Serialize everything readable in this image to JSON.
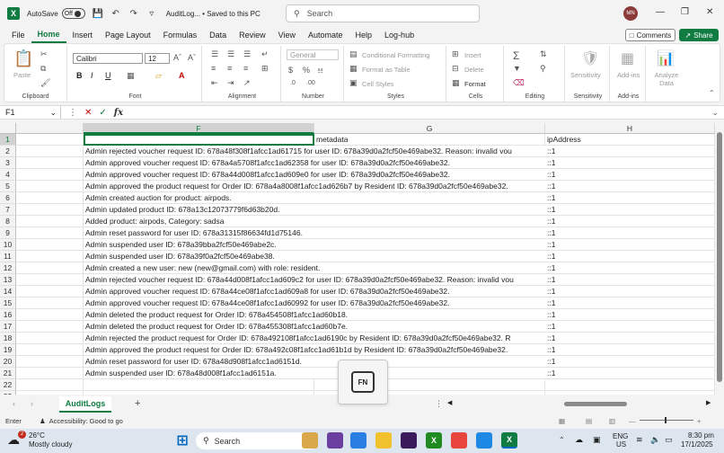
{
  "titlebar": {
    "autosave_label": "AutoSave",
    "autosave_state": "Off",
    "doc_title": "AuditLog... • Saved to this PC",
    "search_placeholder": "Search",
    "user_initials": "MN"
  },
  "menu": {
    "items": [
      "File",
      "Home",
      "Insert",
      "Page Layout",
      "Formulas",
      "Data",
      "Review",
      "View",
      "Automate",
      "Help",
      "Log-hub"
    ],
    "active": "Home",
    "comments_label": "Comments",
    "share_label": "Share"
  },
  "ribbon": {
    "clipboard": {
      "label": "Clipboard",
      "paste": "Paste"
    },
    "font": {
      "label": "Font",
      "name": "Calibri",
      "size": "12"
    },
    "alignment": {
      "label": "Alignment"
    },
    "number": {
      "label": "Number",
      "format": "General"
    },
    "styles": {
      "label": "Styles",
      "conditional": "Conditional Formatting",
      "table": "Format as Table",
      "cell_styles": "Cell Styles"
    },
    "cells": {
      "label": "Cells",
      "insert": "Insert",
      "delete": "Delete",
      "format": "Format"
    },
    "editing": {
      "label": "Editing"
    },
    "sensitivity": {
      "label": "Sensitivity",
      "button": "Sensitivity"
    },
    "addins": {
      "label": "Add-ins",
      "button": "Add-ins"
    },
    "analyze": {
      "button": "Analyze Data"
    }
  },
  "formula_bar": {
    "name_box": "F1",
    "fx": "fx",
    "value": ""
  },
  "grid": {
    "columns": [
      "F",
      "G",
      "H"
    ],
    "rows": [
      {
        "num": "1",
        "f": "",
        "g": "metadata",
        "h": "ipAddress"
      },
      {
        "num": "2",
        "f": "Admin rejected voucher request ID: 678a48f308f1afcc1ad61715 for user ID: 678a39d0a2fcf50e469abe32. Reason: invalid vou",
        "g": "",
        "h": "::1"
      },
      {
        "num": "3",
        "f": "Admin approved voucher request ID: 678a4a5708f1afcc1ad62358 for user ID: 678a39d0a2fcf50e469abe32.",
        "g": "",
        "h": "::1"
      },
      {
        "num": "4",
        "f": "Admin approved voucher request ID: 678a44d008f1afcc1ad609e0 for user ID: 678a39d0a2fcf50e469abe32.",
        "g": "",
        "h": "::1"
      },
      {
        "num": "5",
        "f": "Admin approved the product request for Order ID: 678a4a8008f1afcc1ad626b7 by Resident ID: 678a39d0a2fcf50e469abe32.",
        "g": "",
        "h": "::1"
      },
      {
        "num": "6",
        "f": "Admin created auction for product: airpods.",
        "g": "",
        "h": "::1"
      },
      {
        "num": "7",
        "f": "Admin updated product ID: 678a13c12073779f6d63b20d.",
        "g": "",
        "h": "::1"
      },
      {
        "num": "8",
        "f": "Added product: airpods, Category: sadsa",
        "g": "",
        "h": "::1"
      },
      {
        "num": "9",
        "f": "Admin reset password for user ID: 678a31315f86634fd1d75146.",
        "g": "",
        "h": "::1"
      },
      {
        "num": "10",
        "f": "Admin suspended user ID: 678a39bba2fcf50e469abe2c.",
        "g": "",
        "h": "::1"
      },
      {
        "num": "11",
        "f": "Admin suspended user ID: 678a39f0a2fcf50e469abe38.",
        "g": "",
        "h": "::1"
      },
      {
        "num": "12",
        "f": "Admin created a new user: new (new@gmail.com) with role: resident.",
        "g": "",
        "h": "::1"
      },
      {
        "num": "13",
        "f": "Admin rejected voucher request ID: 678a44d008f1afcc1ad609c2 for user ID: 678a39d0a2fcf50e469abe32. Reason: invalid vou",
        "g": "",
        "h": "::1"
      },
      {
        "num": "14",
        "f": "Admin approved voucher request ID: 678a44ce08f1afcc1ad609a8 for user ID: 678a39d0a2fcf50e469abe32.",
        "g": "",
        "h": "::1"
      },
      {
        "num": "15",
        "f": "Admin approved voucher request ID: 678a44ce08f1afcc1ad60992 for user ID: 678a39d0a2fcf50e469abe32.",
        "g": "",
        "h": "::1"
      },
      {
        "num": "16",
        "f": "Admin deleted the product request for Order ID: 678a454508f1afcc1ad60b18.",
        "g": "",
        "h": "::1"
      },
      {
        "num": "17",
        "f": "Admin deleted the product request for Order ID: 678a455308f1afcc1ad60b7e.",
        "g": "",
        "h": "::1"
      },
      {
        "num": "18",
        "f": "Admin rejected the product request for Order ID: 678a492108f1afcc1ad6190c by Resident ID: 678a39d0a2fcf50e469abe32. R",
        "g": "",
        "h": "::1"
      },
      {
        "num": "19",
        "f": "Admin approved the product request for Order ID: 678a492c08f1afcc1ad61b1d by Resident ID: 678a39d0a2fcf50e469abe32.",
        "g": "",
        "h": "::1"
      },
      {
        "num": "20",
        "f": "Admin reset password for user ID: 678a48d908f1afcc1ad6151d.",
        "g": "",
        "h": "::1"
      },
      {
        "num": "21",
        "f": "Admin suspended user ID: 678a48d008f1afcc1ad6151a.",
        "g": "",
        "h": "::1"
      },
      {
        "num": "22",
        "f": "",
        "g": "",
        "h": ""
      },
      {
        "num": "23",
        "f": "",
        "g": "",
        "h": ""
      }
    ]
  },
  "sheets": {
    "active": "AuditLogs"
  },
  "popup": {
    "key_label": "FN"
  },
  "status": {
    "mode": "Enter",
    "accessibility": "Accessibility: Good to go"
  },
  "taskbar": {
    "weather_temp": "26°C",
    "weather_desc": "Mostly cloudy",
    "weather_badge": "2",
    "search_label": "Search",
    "lang_line1": "ENG",
    "lang_line2": "US",
    "time": "8:30 pm",
    "date": "17/1/2025"
  },
  "colors": {
    "accent": "#107c41"
  }
}
